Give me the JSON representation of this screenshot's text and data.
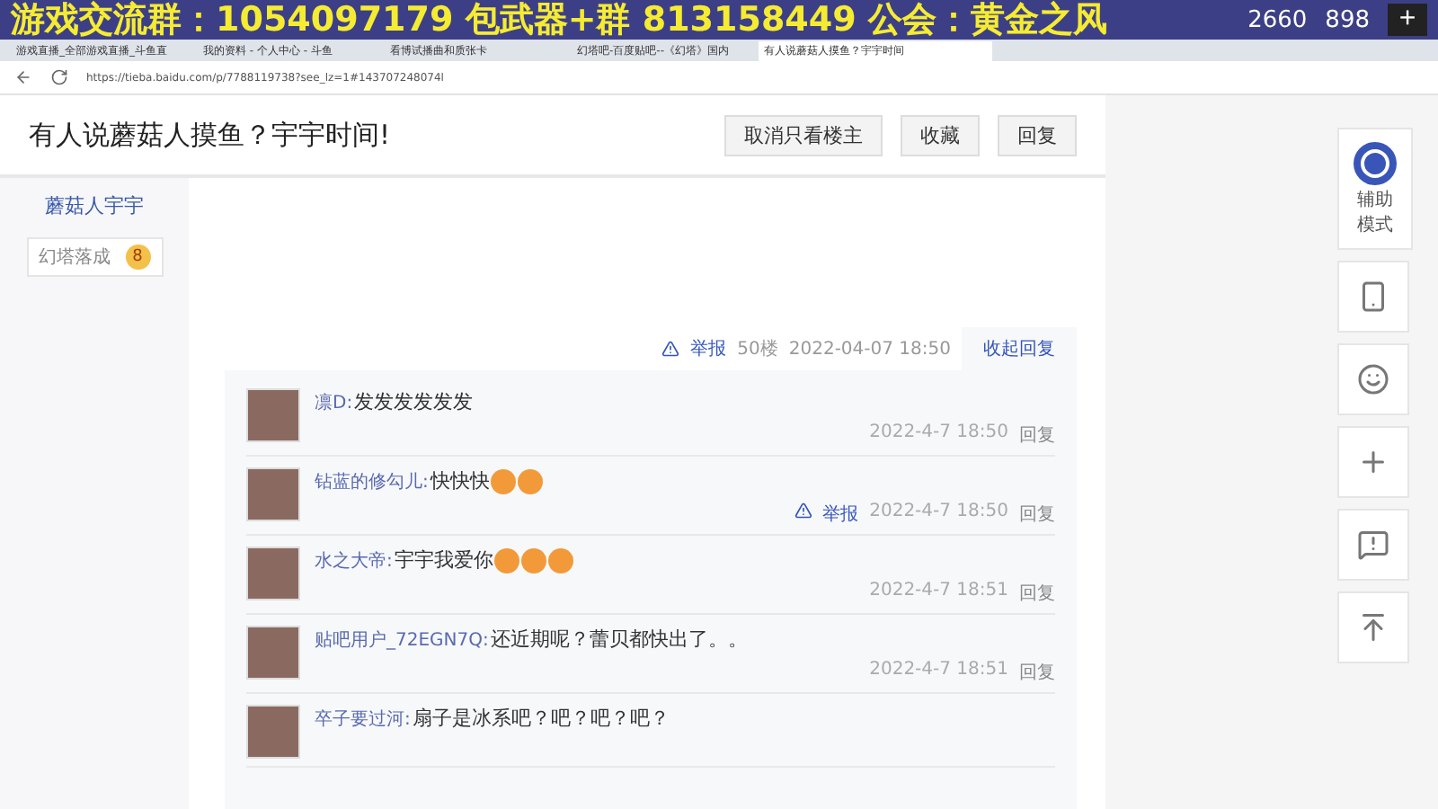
{
  "overlay": {
    "text": "游戏交流群：1054097179  包武器+群 813158449  公会：黄金之风",
    "count_1": "2660",
    "count_2": "898",
    "add": "+"
  },
  "tabs": [
    {
      "label": "游戏直播_全部游戏直播_斗鱼直",
      "selected": false
    },
    {
      "label": "我的资料 - 个人中心 - 斗鱼",
      "selected": false
    },
    {
      "label": "看博试播曲和质张卡",
      "selected": false
    },
    {
      "label": "幻塔吧-百度贴吧--《幻塔》国内",
      "selected": false
    },
    {
      "label": "有人说蘑菇人摸鱼？宇宇时间",
      "selected": true
    }
  ],
  "address": "https://tieba.baidu.com/p/7788119738?see_lz=1#143707248074l",
  "thread": {
    "title": "有人说蘑菇人摸鱼？宇宇时间!",
    "buttons": [
      "取消只看楼主",
      "收藏",
      "回复"
    ]
  },
  "author": {
    "name": "蘑菇人宇宇",
    "badge": "幻塔落成",
    "level": "8"
  },
  "post_footer": {
    "report": "举报",
    "floor": "50楼",
    "time": "2022-04-07 18:50",
    "collapse": "收起回复"
  },
  "comments": [
    {
      "user": "凛D:",
      "text": "发发发发发发",
      "time": "2022-4-7 18:50",
      "reply": "回复"
    },
    {
      "user": "钻蓝的修勾儿:",
      "text": "快快快",
      "emojis": [
        {
          "kind": "face"
        },
        {
          "kind": "face"
        }
      ],
      "time": "2022-4-7 18:50",
      "reply": "回复",
      "report": "举报"
    },
    {
      "user": "水之大帝:",
      "text": "宇宇我爱你",
      "emojis": [
        {
          "kind": "face"
        },
        {
          "kind": "face"
        },
        {
          "kind": "face"
        }
      ],
      "time": "2022-4-7 18:51",
      "reply": "回复"
    },
    {
      "user": "贴吧用户_72EGN7Q:",
      "text": "还近期呢？蕾贝都快出了。。",
      "time": "2022-4-7 18:51",
      "reply": "回复"
    },
    {
      "user": "卒子要过河:",
      "text": "扇子是冰系吧？吧？吧？吧？"
    }
  ],
  "side_tools": {
    "assist": "辅助模式"
  }
}
